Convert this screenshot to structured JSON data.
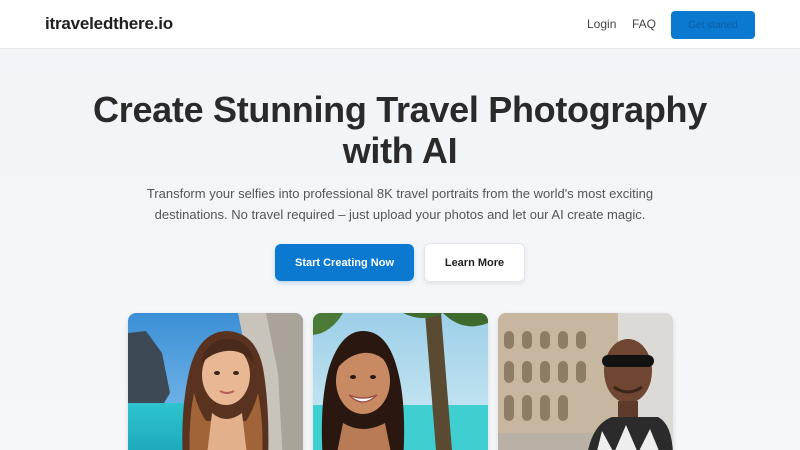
{
  "nav": {
    "logo": "itraveledthere.io",
    "login": "Login",
    "faq": "FAQ",
    "cta": "Get started"
  },
  "hero": {
    "title": "Create Stunning Travel Photography with AI",
    "subtitle": "Transform your selfies into professional 8K travel portraits from the world's most exciting destinations. No travel required – just upload your photos and let our AI create magic.",
    "primary_button": "Start Creating Now",
    "secondary_button": "Learn More"
  },
  "colors": {
    "accent": "#0b79d0",
    "background": "#f4f6f9"
  },
  "gallery": [
    {
      "name": "woman-coastal-cliff-photo"
    },
    {
      "name": "woman-tropical-beach-photo"
    },
    {
      "name": "man-colosseum-photo"
    }
  ]
}
